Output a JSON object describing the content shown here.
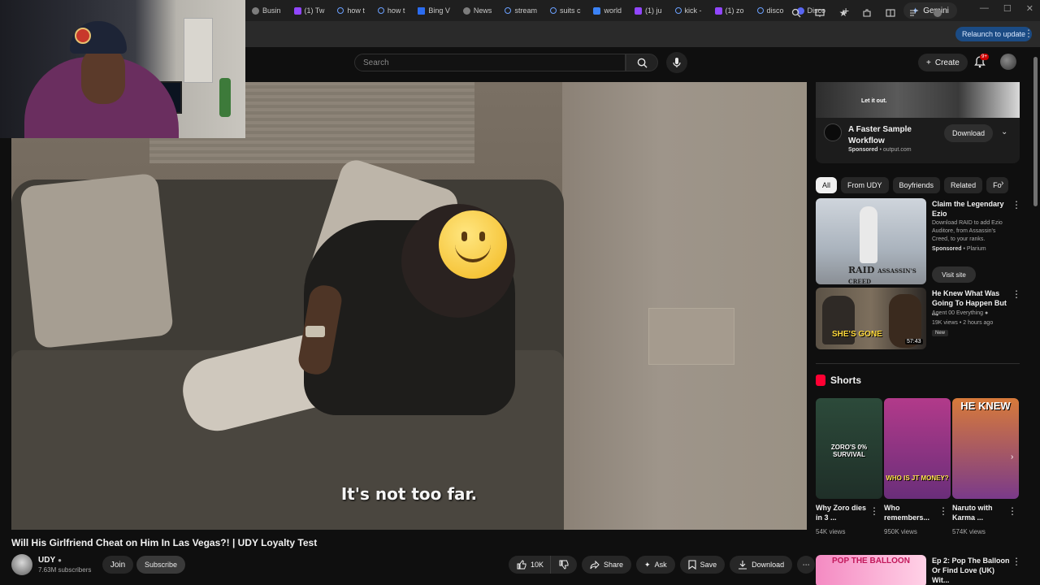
{
  "browser": {
    "tabs": [
      {
        "label": "Busin",
        "icon": "generic"
      },
      {
        "label": "(1) Tw",
        "icon": "twitch"
      },
      {
        "label": "how t",
        "icon": "search"
      },
      {
        "label": "how t",
        "icon": "search"
      },
      {
        "label": "Bing V",
        "icon": "bing"
      },
      {
        "label": "News",
        "icon": "news"
      },
      {
        "label": "stream",
        "icon": "search"
      },
      {
        "label": "suits c",
        "icon": "search"
      },
      {
        "label": "world",
        "icon": "bing"
      },
      {
        "label": "(1) ju",
        "icon": "twitch"
      },
      {
        "label": "kick -",
        "icon": "search"
      },
      {
        "label": "(1) zo",
        "icon": "twitch"
      },
      {
        "label": "disco",
        "icon": "search"
      },
      {
        "label": "Disco",
        "icon": "discord"
      }
    ],
    "new_tab": "+",
    "gemini_label": "Gemini",
    "relaunch_label": "Relaunch to update",
    "window_controls": [
      "—",
      "☐",
      "✕"
    ]
  },
  "header": {
    "search_placeholder": "Search",
    "create_label": "Create",
    "notif_badge": "9+"
  },
  "video": {
    "subtitle": "It's not too far.",
    "title": "Will His Girlfriend Cheat on Him In Las Vegas?! | UDY Loyalty Test"
  },
  "channel": {
    "name": "UDY",
    "subscribers": "7.63M subscribers",
    "join_label": "Join",
    "subscribe_label": "Subscribe"
  },
  "actions": {
    "likes": "10K",
    "share": "Share",
    "ask": "Ask",
    "save": "Save",
    "download": "Download"
  },
  "ad": {
    "thumb_tag": "Let it out.",
    "title": "A Faster Sample Workflow",
    "sponsored": "Sponsored",
    "domain": "output.com",
    "button": "Download"
  },
  "chips": [
    "All",
    "From UDY",
    "Boyfriends",
    "Related",
    "Fo"
  ],
  "recommendations": [
    {
      "title": "Claim the Legendary Ezio",
      "desc": "Download RAID to add Ezio Auditore, from Assassin's Creed, to your ranks.",
      "sponsored": "Sponsored",
      "source": "Plarium",
      "button": "Visit site",
      "thumb_logo": "RAID",
      "thumb_sub": "ASSASSIN'S CREED"
    },
    {
      "title": "He Knew What Was Going To Happen But ...",
      "channel": "Agent 00 Everything",
      "meta": "19K views • 2 hours ago",
      "badge": "New",
      "duration": "57:43",
      "thumb_caption": "SHE'S GONE"
    },
    {
      "title": "Ep 2: Pop The Balloon Or Find Love (UK) Wit...",
      "thumb_caption": "POP THE BALLOON"
    }
  ],
  "shorts": {
    "heading": "Shorts",
    "items": [
      {
        "title": "Why Zoro dies in 3 ...",
        "views": "54K views",
        "overlay": "ZORO'S 0% SURVIVAL"
      },
      {
        "title": "Who remembers...",
        "views": "950K views",
        "overlay": "WHO IS JT MONEY?"
      },
      {
        "title": "Naruto with Karma ...",
        "views": "574K views",
        "overlay": "HE KNEW"
      }
    ]
  },
  "colors": {
    "background": "#0f0f0f",
    "accent_red": "#ff0033",
    "chip_active": "#f1f1f1",
    "relaunch": "#1b4b84"
  }
}
